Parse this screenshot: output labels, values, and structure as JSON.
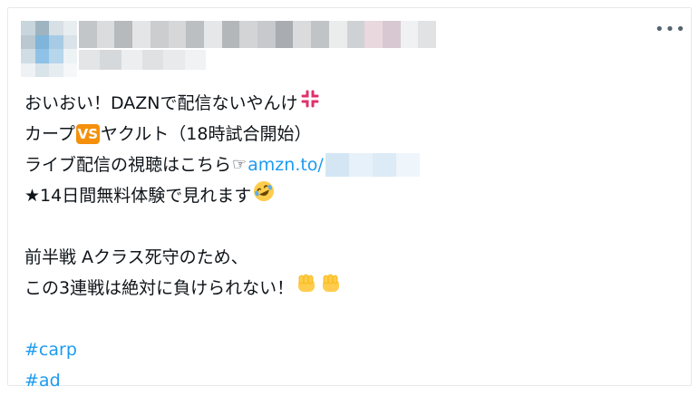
{
  "tweet": {
    "more_label": "•••",
    "lines": {
      "l1": "おいおい！DAZNで配信ないやんけ",
      "l2a": "カープ",
      "l2b": "VS",
      "l2c": "ヤクルト（18時試合開始）",
      "l3a": "ライブ配信の視聴はこちら",
      "l3b": "☞",
      "l3link": "amzn.to/",
      "l4": "★14日間無料体験で見れます",
      "l5": "前半戦 Aクラス死守のため、",
      "l6": "この3連戦は絶対に負けられない！"
    },
    "hashtags": [
      "#carp",
      "#ad"
    ],
    "icons": {
      "anger": "anger-symbol-icon",
      "vs": "vs-button-icon",
      "pointer": "pointing-hand-icon",
      "rofl": "rolling-laughing-face-icon",
      "fist": "raised-fist-icon"
    },
    "colors": {
      "text": "#0f1419",
      "link": "#1d9bf0",
      "vs_badge": "#f4900c",
      "fist": "#ffcc4d"
    }
  }
}
